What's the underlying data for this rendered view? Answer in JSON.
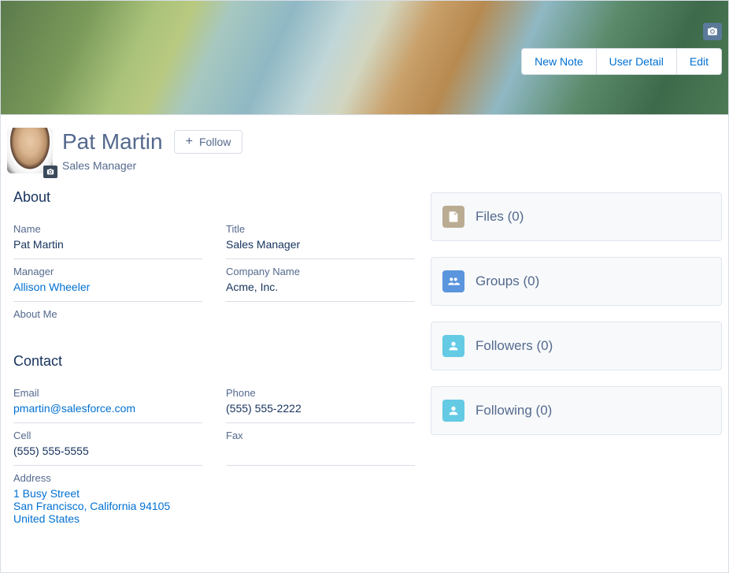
{
  "banner": {
    "actions": {
      "new_note": "New Note",
      "user_detail": "User Detail",
      "edit": "Edit"
    }
  },
  "profile": {
    "name": "Pat Martin",
    "subtitle": "Sales Manager",
    "follow_label": "Follow"
  },
  "about": {
    "title": "About",
    "fields": {
      "name_label": "Name",
      "name_value": "Pat Martin",
      "title_label": "Title",
      "title_value": "Sales Manager",
      "manager_label": "Manager",
      "manager_value": "Allison Wheeler",
      "company_label": "Company Name",
      "company_value": "Acme, Inc.",
      "aboutme_label": "About Me"
    }
  },
  "contact": {
    "title": "Contact",
    "fields": {
      "email_label": "Email",
      "email_value": "pmartin@salesforce.com",
      "phone_label": "Phone",
      "phone_value": "(555) 555-2222",
      "cell_label": "Cell",
      "cell_value": "(555) 555-5555",
      "fax_label": "Fax",
      "fax_value": "",
      "address_label": "Address",
      "address_line1": "1 Busy Street",
      "address_line2": "San Francisco, California 94105",
      "address_line3": "United States"
    }
  },
  "cards": {
    "files": "Files (0)",
    "groups": "Groups (0)",
    "followers": "Followers (0)",
    "following": "Following (0)"
  }
}
